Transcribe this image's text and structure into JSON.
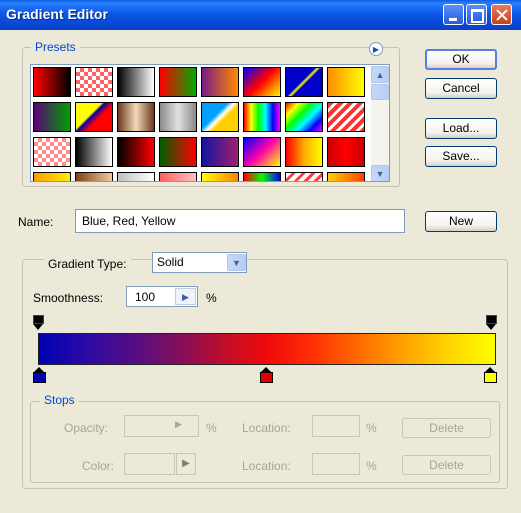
{
  "window": {
    "title": "Gradient Editor"
  },
  "presets": {
    "legend": "Presets",
    "menu_glyph": "▶",
    "swatches": [
      [
        "linear-gradient(90deg,#ff0000,#000000)",
        "repeating-conic-gradient(#ff6464 0 25%, #ffffff 0 50%) 0 0/8px 8px",
        "linear-gradient(90deg,#000000,#ffffff)",
        "linear-gradient(90deg,#ff0000,#00aa00)",
        "linear-gradient(90deg,#7a1b8a,#ff8a00)",
        "linear-gradient(135deg,#0000ff,#ff0000,#ffff00)",
        "linear-gradient(135deg,#0000c8 45%,#ffff00 50%,#0000c8 55%)",
        "linear-gradient(90deg,#ff8c00,#ffff00)"
      ],
      [
        "linear-gradient(90deg,#5a0078,#00a000)",
        "linear-gradient(135deg,#ffff00 40%,#0000b4 45%,#ff0000 60%)",
        "linear-gradient(90deg,#6b3a1e,#f4d8b8,#6b3a1e)",
        "linear-gradient(90deg,#8a8a8a,#e0e0e0,#8a8a8a)",
        "linear-gradient(135deg,#00a0ff 40%,#ffffff 50%,#ffd000 60%)",
        "linear-gradient(90deg,#ff0000,#ffff00,#00ff00,#00ffff,#0000ff,#ff00ff)",
        "linear-gradient(135deg,#ff0000,#ffff00,#00ff00,#00ffff,#0000ff,#ff00ff)",
        "repeating-linear-gradient(135deg,#ff3030 0 4px,#ffffff 4px 7px)"
      ],
      [
        "repeating-conic-gradient(#ff8a8a 0 25%, #ffffff 0 50%) 0 0/8px 8px",
        "linear-gradient(90deg,#000000,#ffffff)",
        "linear-gradient(90deg,#000000,#ff0000)",
        "linear-gradient(90deg,#006000,#ff0000)",
        "linear-gradient(90deg,#1414a0,#a02070)",
        "linear-gradient(135deg,#0000ff,#ff00aa,#ffff00)",
        "linear-gradient(90deg,#ff0000,#ffaa00,#ffff00)",
        "linear-gradient(90deg,#c80000,#ff0000,#c80000)"
      ],
      [
        "linear-gradient(90deg,#ff9900,#ffee00)",
        "linear-gradient(90deg,#804010,#f5c9a0)",
        "linear-gradient(90deg,#c0c0c0,#ffffff)",
        "linear-gradient(90deg,#ff6060,#ffc0c0)",
        "linear-gradient(90deg,#ffff00,#ff8000)",
        "linear-gradient(90deg,#ff0000,#00ff00,#0000ff)",
        "repeating-linear-gradient(135deg,#ffffff 0 4px,#ff4040 4px 7px)",
        "linear-gradient(90deg,#ffd000,#ff4000)"
      ]
    ],
    "scroll_up": "▲",
    "scroll_down": "▼"
  },
  "buttons": {
    "ok": "OK",
    "cancel": "Cancel",
    "load": "Load...",
    "save": "Save...",
    "new": "New"
  },
  "name": {
    "label": "Name:",
    "value": "Blue, Red, Yellow"
  },
  "gradient": {
    "type_label": "Gradient Type:",
    "type_value": "Solid",
    "dropdown_glyph": "▼",
    "smoothness_label": "Smoothness:",
    "smoothness_value": "100",
    "smoothness_arrow": "▶",
    "smoothness_unit": "%",
    "color_stops": {
      "left": "#0000b4",
      "middle": "#e00000",
      "right": "#ffff00"
    }
  },
  "stops": {
    "legend": "Stops",
    "opacity_label": "Opacity:",
    "opacity_arrow": "▶",
    "opacity_unit": "%",
    "location_label": "Location:",
    "location_unit": "%",
    "delete_label": "Delete",
    "color_label": "Color:",
    "color_arrow": "▶"
  }
}
